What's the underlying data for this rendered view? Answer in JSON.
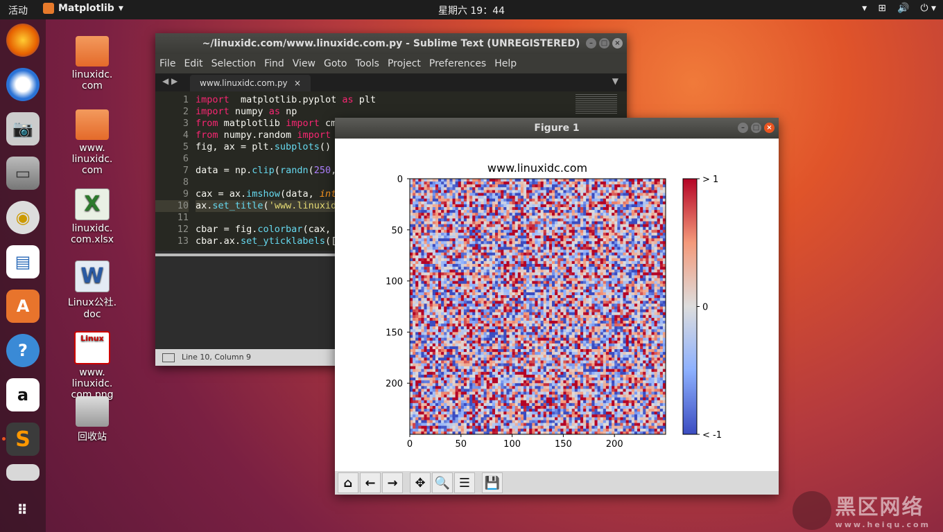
{
  "topbar": {
    "activities": "活动",
    "app_name": "Matplotlib",
    "clock": "星期六 19：44"
  },
  "dock": {
    "items": [
      "firefox-icon",
      "thunderbird-icon",
      "camera-icon",
      "files-icon",
      "speaker-icon",
      "writer-icon",
      "software-icon",
      "help-icon",
      "amazon-icon",
      "sublime-icon",
      "apps-grid-icon"
    ]
  },
  "desktop": {
    "icons": [
      {
        "label": "linuxidc.\ncom",
        "type": "folder"
      },
      {
        "label": "www.\nlinuxidc.\ncom",
        "type": "folder"
      },
      {
        "label": "linuxidc.\ncom.xlsx",
        "type": "xlsx",
        "glyph": "X"
      },
      {
        "label": "Linux公社.\ndoc",
        "type": "doc",
        "glyph": "W"
      },
      {
        "label": "www.\nlinuxidc.\ncom.png",
        "type": "png",
        "glyph": "Linux"
      },
      {
        "label": "回收站",
        "type": "trash"
      }
    ]
  },
  "sublime": {
    "title": "~/linuxidc.com/www.linuxidc.com.py - Sublime Text (UNREGISTERED)",
    "menu": [
      "File",
      "Edit",
      "Selection",
      "Find",
      "View",
      "Goto",
      "Tools",
      "Project",
      "Preferences",
      "Help"
    ],
    "tab": "www.linuxidc.com.py",
    "tab_close": "×",
    "status": "Line 10, Column 9",
    "line_numbers": [
      "1",
      "2",
      "3",
      "4",
      "5",
      "6",
      "7",
      "8",
      "9",
      "10",
      "11",
      "12",
      "13"
    ],
    "code": [
      [
        [
          "kw",
          "import"
        ],
        [
          "",
          "  matplotlib.pyplot "
        ],
        [
          "kw",
          "as"
        ],
        [
          "",
          " plt"
        ]
      ],
      [
        [
          "kw",
          "import"
        ],
        [
          "",
          " numpy "
        ],
        [
          "kw",
          "as"
        ],
        [
          "",
          " np"
        ]
      ],
      [
        [
          "kw",
          "from"
        ],
        [
          "",
          " matplotlib "
        ],
        [
          "kw",
          "import"
        ],
        [
          "",
          " cm"
        ]
      ],
      [
        [
          "kw",
          "from"
        ],
        [
          "",
          " numpy.random "
        ],
        [
          "kw",
          "import"
        ]
      ],
      [
        [
          "",
          "fig, ax = plt."
        ],
        [
          "fn",
          "subplots"
        ],
        [
          "",
          "()"
        ]
      ],
      [],
      [
        [
          "",
          "data = np."
        ],
        [
          "fn",
          "clip"
        ],
        [
          "",
          "("
        ],
        [
          "fn",
          "randn"
        ],
        [
          "",
          "("
        ],
        [
          "num",
          "250"
        ],
        [
          "",
          ","
        ]
      ],
      [],
      [
        [
          "",
          "cax = ax."
        ],
        [
          "fn",
          "imshow"
        ],
        [
          "",
          "(data, "
        ],
        [
          "it",
          "int"
        ]
      ],
      [
        [
          "",
          "ax."
        ],
        [
          "fn",
          "set_title"
        ],
        [
          "",
          "("
        ],
        [
          "str",
          "'www.linuxid"
        ]
      ],
      [],
      [
        [
          "",
          "cbar = fig."
        ],
        [
          "fn",
          "colorbar"
        ],
        [
          "",
          "(cax,"
        ]
      ],
      [
        [
          "",
          "cbar.ax."
        ],
        [
          "fn",
          "set_yticklabels"
        ],
        [
          "",
          "(["
        ]
      ]
    ]
  },
  "figure": {
    "title": "Figure 1",
    "toolbar": [
      {
        "name": "home-icon",
        "glyph": "⌂"
      },
      {
        "name": "back-icon",
        "glyph": "←"
      },
      {
        "name": "forward-icon",
        "glyph": "→"
      },
      {
        "name": "pan-icon",
        "glyph": "✥"
      },
      {
        "name": "zoom-icon",
        "glyph": "🔍"
      },
      {
        "name": "configure-icon",
        "glyph": "☰"
      },
      {
        "name": "save-icon",
        "glyph": "💾"
      }
    ]
  },
  "chart_data": {
    "type": "heatmap",
    "title": "www.linuxidc.com",
    "rows": 250,
    "cols": 250,
    "value_range": [
      -1,
      1
    ],
    "cmap": "coolwarm",
    "x_ticks": [
      0,
      50,
      100,
      150,
      200
    ],
    "y_ticks": [
      0,
      50,
      100,
      150,
      200
    ],
    "colorbar_ticks": [
      {
        "value": 1,
        "label": "> 1"
      },
      {
        "value": 0,
        "label": "0"
      },
      {
        "value": -1,
        "label": "< -1"
      }
    ],
    "colors": {
      "low": "#3b4cc0",
      "mid": "#dddddd",
      "high": "#b40426"
    }
  },
  "watermark": {
    "big": "黑区网络",
    "small": "www.heiqu.com"
  }
}
